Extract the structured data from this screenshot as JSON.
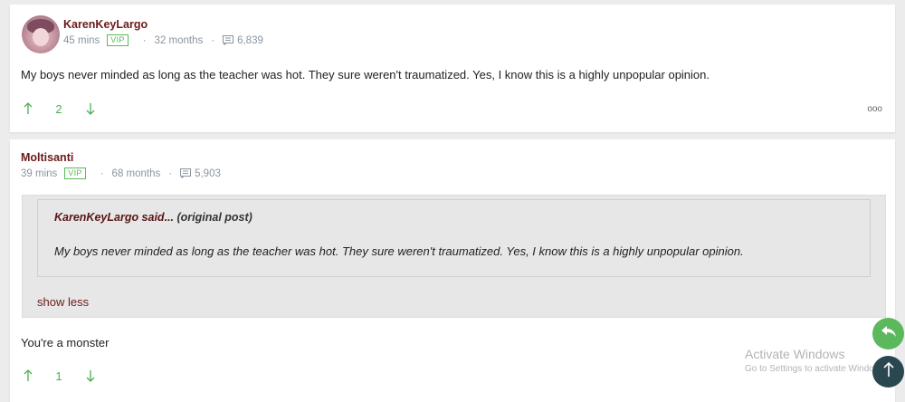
{
  "post1": {
    "username": "KarenKeyLargo",
    "time": "45 mins",
    "badge": "VIP",
    "tenure": "32 months",
    "post_count": "6,839",
    "text": "My boys never minded as long as the teacher was hot. They sure weren't traumatized. Yes, I know this is a highly unpopular opinion.",
    "votes": "2",
    "more": "ooo"
  },
  "post2": {
    "username": "Moltisanti",
    "time": "39 mins",
    "badge": "VIP",
    "tenure": "68 months",
    "post_count": "5,903",
    "quote": {
      "author_said": "KarenKeyLargo said...",
      "tag": "(original post)",
      "text": "My boys never minded as long as the teacher was hot. They sure weren't traumatized. Yes, I know this is a highly unpopular opinion.",
      "toggle": "show less"
    },
    "text": "You're a monster",
    "votes": "1"
  },
  "watermark": {
    "line1": "Activate Windows",
    "line2": "Go to Settings to activate Windows."
  },
  "icons": {
    "upvote": "arrow-up-icon",
    "downvote": "arrow-down-icon",
    "posts": "comment-icon",
    "reply": "reply-icon",
    "scroll_top": "arrow-up-icon"
  },
  "colors": {
    "username": "#6b1a1a",
    "vote_count": "#4caf50",
    "vip": "#5cb85c",
    "fab_reply": "#5cb85c",
    "fab_top": "#2a4750"
  }
}
